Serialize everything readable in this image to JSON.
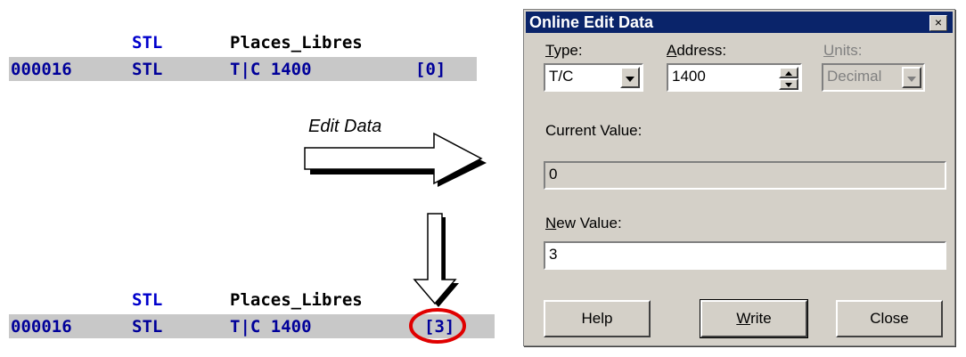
{
  "ladder_top": {
    "header_instr": "STL",
    "header_name": "Places_Libres",
    "row_address": "000016",
    "row_instr": "STL",
    "row_operand": "T|C 1400",
    "row_value": "[0]"
  },
  "ladder_bottom": {
    "header_instr": "STL",
    "header_name": "Places_Libres",
    "row_address": "000016",
    "row_instr": "STL",
    "row_operand": "T|C 1400",
    "row_value": "[3]"
  },
  "annotation": {
    "edit_label": "Edit Data",
    "highlight_color": "#e00000"
  },
  "dialog": {
    "title": "Online Edit Data",
    "close_glyph": "×",
    "type": {
      "label_first": "T",
      "label_rest": "ype:",
      "value": "T/C"
    },
    "address": {
      "label_first": "A",
      "label_rest": "ddress:",
      "value": "1400"
    },
    "units": {
      "label_first": "U",
      "label_rest": "nits:",
      "value": "Decimal"
    },
    "current_value": {
      "label": "Current Value:",
      "value": "0"
    },
    "new_value": {
      "label_first": "N",
      "label_rest": "ew Value:",
      "value": "3"
    },
    "buttons": {
      "help": "Help",
      "write_first": "W",
      "write_rest": "rite",
      "close": "Close"
    },
    "title_bar_color": "#0a246a"
  }
}
